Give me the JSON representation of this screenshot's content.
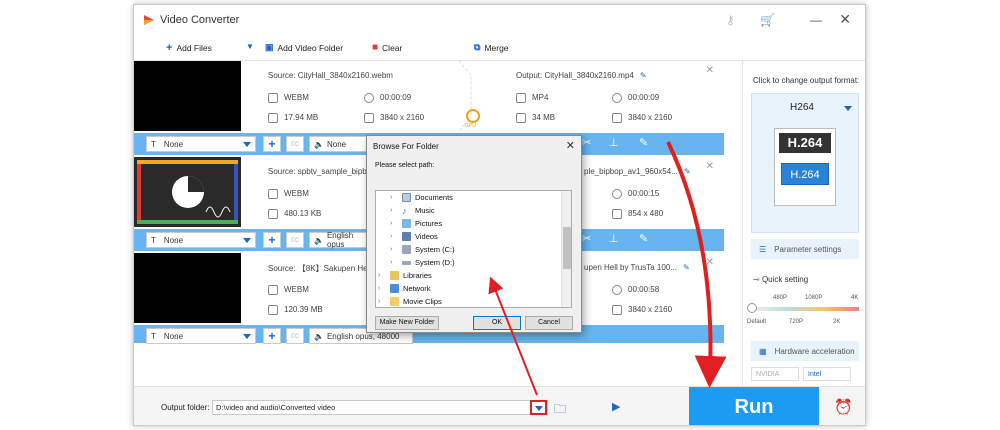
{
  "app": {
    "title": "Video Converter"
  },
  "toolbar": {
    "add_files": "Add Files",
    "add_video_folder": "Add Video Folder",
    "clear": "Clear",
    "merge": "Merge"
  },
  "items": [
    {
      "source": "Source: CityHall_3840x2160.webm",
      "src_format": "WEBM",
      "src_duration": "00:00:09",
      "src_size": "17.94 MB",
      "src_resolution": "3840 x 2160",
      "output": "Output: CityHall_3840x2160.mp4",
      "out_format": "MP4",
      "out_duration": "00:00:09",
      "out_size": "34 MB",
      "out_resolution": "3840 x 2160",
      "subtitle": "None",
      "audio": "None",
      "gpu": "GPU"
    },
    {
      "source": "Source: spbtv_sample_bipb",
      "src_format": "WEBM",
      "src_size": "480.13 KB",
      "output": "ple_bipbop_av1_960x54...",
      "out_duration": "00:00:15",
      "out_resolution": "854 x 480",
      "subtitle": "None",
      "audio": "English opus"
    },
    {
      "source": "Source: 【8K】Sakupen He",
      "src_format": "WEBM",
      "src_size": "120.39 MB",
      "output": "upen Hell by TrusTa 100...",
      "out_duration": "00:00:58",
      "out_resolution": "3840 x 2160",
      "subtitle": "None",
      "audio": "English opus, 48000"
    }
  ],
  "right_panel": {
    "title": "Click to change output format:",
    "format": "H264",
    "format_badge_top": "H.264",
    "format_badge_bottom": "H.264",
    "parameter_settings": "Parameter settings",
    "quick_setting": "Quick setting",
    "quality_top_labels": [
      "480P",
      "1080P",
      "4K"
    ],
    "quality_bottom_labels": [
      "Default",
      "720P",
      "2K"
    ],
    "hardware_acceleration": "Hardware acceleration",
    "vendors": [
      "NVIDIA",
      "Intel"
    ]
  },
  "bottom": {
    "output_folder_label": "Output folder:",
    "output_folder_value": "D:\\video and audio\\Converted video",
    "run": "Run"
  },
  "dialog": {
    "title": "Browse For Folder",
    "prompt": "Please select path:",
    "tree": [
      "Documents",
      "Music",
      "Pictures",
      "Videos",
      "System (C:)",
      "System (D:)",
      "Libraries",
      "Network",
      "Movie Clips"
    ],
    "make_new_folder": "Make New Folder",
    "ok": "OK",
    "cancel": "Cancel"
  },
  "colors": {
    "accent_blue": "#1d9af2",
    "bar_blue": "#66b5f0",
    "highlight_red": "#e02020"
  }
}
